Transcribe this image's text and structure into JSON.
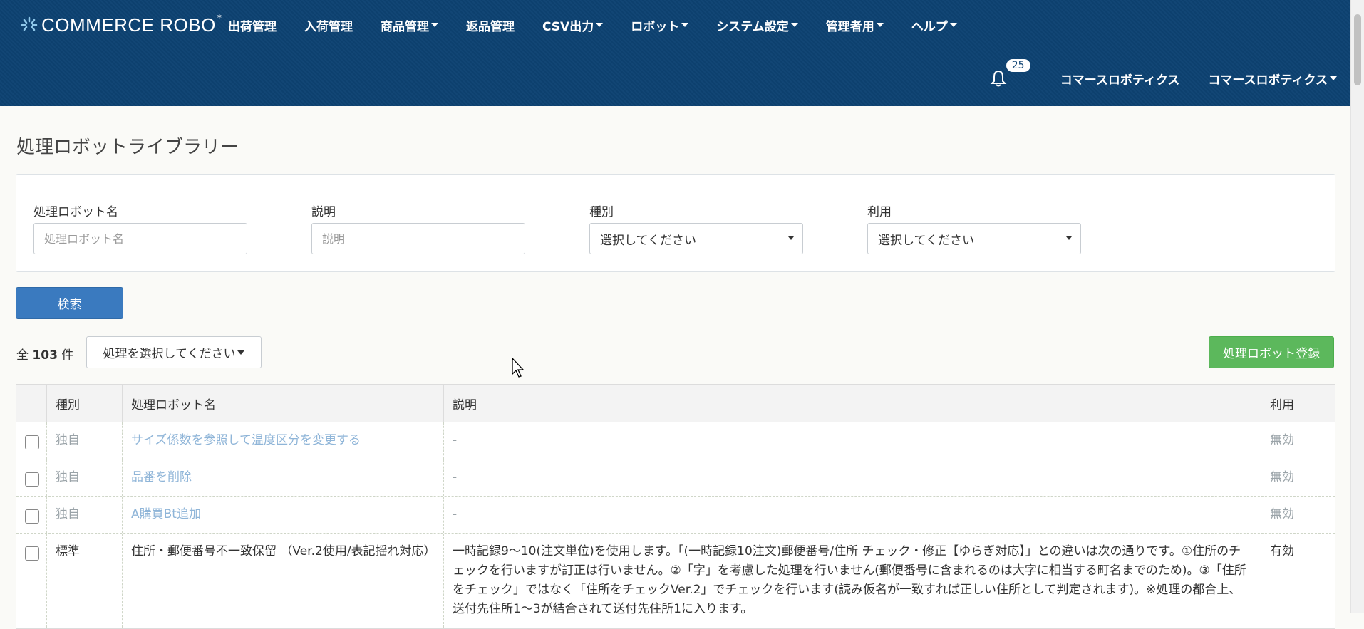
{
  "header": {
    "logo_text": "COMMERCE ROBO",
    "nav": [
      {
        "label": "出荷管理",
        "dropdown": false
      },
      {
        "label": "入荷管理",
        "dropdown": false
      },
      {
        "label": "商品管理",
        "dropdown": true
      },
      {
        "label": "返品管理",
        "dropdown": false
      },
      {
        "label": "CSV出力",
        "dropdown": true
      },
      {
        "label": "ロボット",
        "dropdown": true
      },
      {
        "label": "システム設定",
        "dropdown": true
      },
      {
        "label": "管理者用",
        "dropdown": true
      },
      {
        "label": "ヘルプ",
        "dropdown": true
      }
    ],
    "notification_count": "25",
    "company_link": "コマースロボティクス",
    "user_menu": "コマースロボティクス"
  },
  "page": {
    "title": "処理ロボットライブラリー"
  },
  "filters": {
    "name_label": "処理ロボット名",
    "name_placeholder": "処理ロボット名",
    "desc_label": "説明",
    "desc_placeholder": "説明",
    "type_label": "種別",
    "type_value": "選択してください",
    "usage_label": "利用",
    "usage_value": "選択してください"
  },
  "actions": {
    "search_label": "検索",
    "count_prefix": "全",
    "count_value": "103",
    "count_suffix": "件",
    "bulk_action": "処理を選択してください",
    "register_label": "処理ロボット登録"
  },
  "table": {
    "headers": [
      "種別",
      "処理ロボット名",
      "説明",
      "利用"
    ],
    "rows": [
      {
        "type": "独自",
        "name": "サイズ係数を参照して温度区分を変更する",
        "desc": "-",
        "usage": "無効",
        "active": false
      },
      {
        "type": "独自",
        "name": "品番を削除",
        "desc": "-",
        "usage": "無効",
        "active": false
      },
      {
        "type": "独自",
        "name": "A購買Bt追加",
        "desc": "-",
        "usage": "無効",
        "active": false
      },
      {
        "type": "標準",
        "name": "住所・郵便番号不一致保留 （Ver.2使用/表記揺れ対応）",
        "desc": "一時記録9～10(注文単位)を使用します。「(一時記録10注文)郵便番号/住所 チェック・修正【ゆらぎ対応】」との違いは次の通りです。①住所のチェックを行いますが訂正は行いません。②「字」を考慮した処理を行いません(郵便番号に含まれるのは大字に相当する町名までのため)。③「住所をチェック」ではなく「住所をチェックVer.2」でチェックを行います(読み仮名が一致すれば正しい住所として判定されます)。※処理の都合上、送付先住所1～3が結合されて送付先住所1に入ります。",
        "usage": "有効",
        "active": true
      }
    ]
  }
}
